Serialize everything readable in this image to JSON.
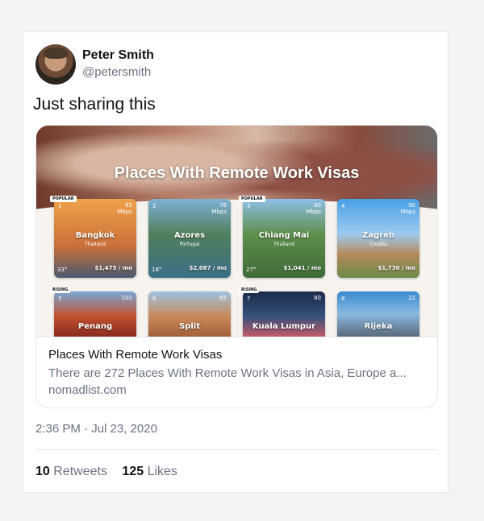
{
  "tweet": {
    "user": {
      "name": "Peter Smith",
      "handle": "@petersmith"
    },
    "text": "Just sharing this",
    "card": {
      "image": {
        "headline": "Places With Remote Work Visas",
        "tiles": [
          {
            "rank": "1",
            "city": "Bangkok",
            "country": "Thailand",
            "wifi": "85",
            "wifi_unit": "Mbps",
            "temp": "33°",
            "price": "$1,475 / mo",
            "badge": "POPULAR"
          },
          {
            "rank": "2",
            "city": "Azores",
            "country": "Portugal",
            "wifi": "76",
            "wifi_unit": "Mbps",
            "temp": "18°",
            "price": "$2,087 / mo",
            "badge": ""
          },
          {
            "rank": "3",
            "city": "Chiang Mai",
            "country": "Thailand",
            "wifi": "60",
            "wifi_unit": "Mbps",
            "temp": "27°",
            "price": "$1,041 / mo",
            "badge": "POPULAR"
          },
          {
            "rank": "4",
            "city": "Zagreb",
            "country": "Croatia",
            "wifi": "90",
            "wifi_unit": "Mbps",
            "temp": "",
            "price": "$1,730 / mo",
            "badge": ""
          },
          {
            "rank": "5",
            "city": "Penang",
            "country": "",
            "wifi": "101",
            "wifi_unit": "",
            "temp": "",
            "price": "",
            "badge": "RISING"
          },
          {
            "rank": "6",
            "city": "Split",
            "country": "",
            "wifi": "65",
            "wifi_unit": "",
            "temp": "",
            "price": "",
            "badge": ""
          },
          {
            "rank": "7",
            "city": "Kuala Lumpur",
            "country": "",
            "wifi": "80",
            "wifi_unit": "",
            "temp": "",
            "price": "",
            "badge": "RISING"
          },
          {
            "rank": "8",
            "city": "Rijeka",
            "country": "",
            "wifi": "22",
            "wifi_unit": "",
            "temp": "",
            "price": "",
            "badge": ""
          }
        ]
      },
      "title": "Places With Remote Work Visas",
      "description": "There are 272 Places With Remote Work Visas in Asia, Europe a...",
      "domain": "nomadlist.com"
    },
    "timestamp": "2:36 PM · Jul 23, 2020",
    "stats": {
      "retweets_count": "10",
      "retweets_label": "Retweets",
      "likes_count": "125",
      "likes_label": "Likes"
    }
  },
  "colors": {
    "muted_text": "#6b7280",
    "border": "#e5e7eb",
    "background": "#f3f4f6"
  }
}
